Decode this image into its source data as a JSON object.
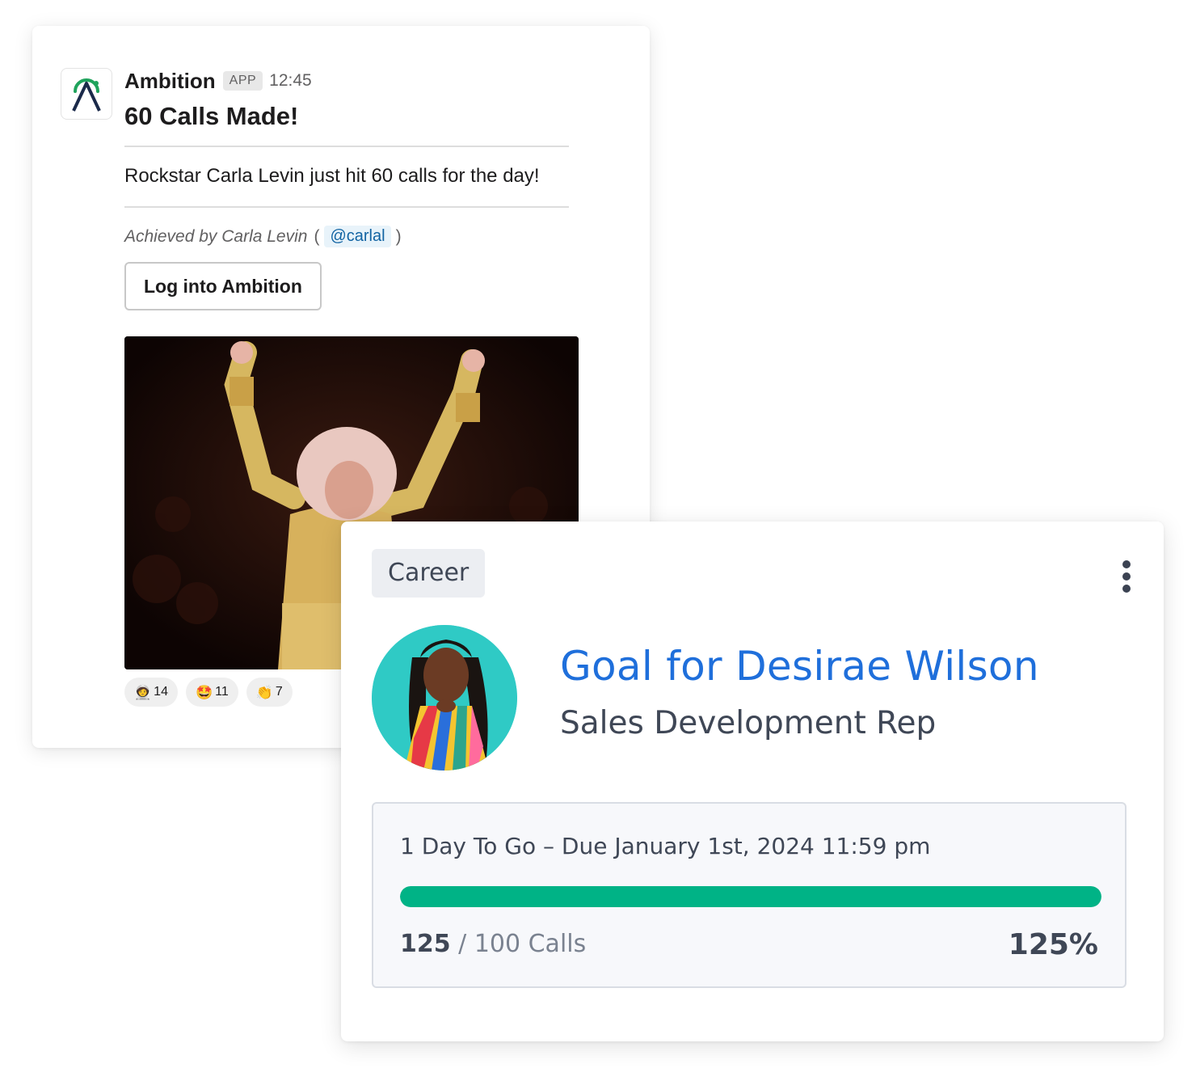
{
  "message": {
    "app_name": "Ambition",
    "app_badge": "APP",
    "time": "12:45",
    "title": "60 Calls Made!",
    "text": "Rockstar Carla Levin just hit 60 calls for the day!",
    "achieved_by": "Achieved by Carla Levin",
    "open_paren": "(",
    "mention": "@carlal",
    "close_paren": ")",
    "button_label": "Log into Ambition",
    "reactions": [
      {
        "emoji": "🧑‍🚀",
        "icon": "astronaut-icon",
        "count": "14"
      },
      {
        "emoji": "🤩",
        "icon": "star-struck-icon",
        "count": "11"
      },
      {
        "emoji": "👏",
        "icon": "clapping-hands-icon",
        "count": "7"
      }
    ]
  },
  "goal": {
    "tag": "Career",
    "title": "Goal for Desirae Wilson",
    "role": "Sales Development Rep",
    "due_line": "1 Day To Go – Due January 1st, 2024 11:59 pm",
    "current": "125",
    "separator": " / ",
    "target_text": "100 Calls",
    "percent_label": "125%",
    "progress_fraction": 1.0
  },
  "colors": {
    "accent_blue": "#1f6fdb",
    "progress_green": "#00b386",
    "logo_green": "#1fa35c",
    "logo_navy": "#1b2a4a"
  }
}
